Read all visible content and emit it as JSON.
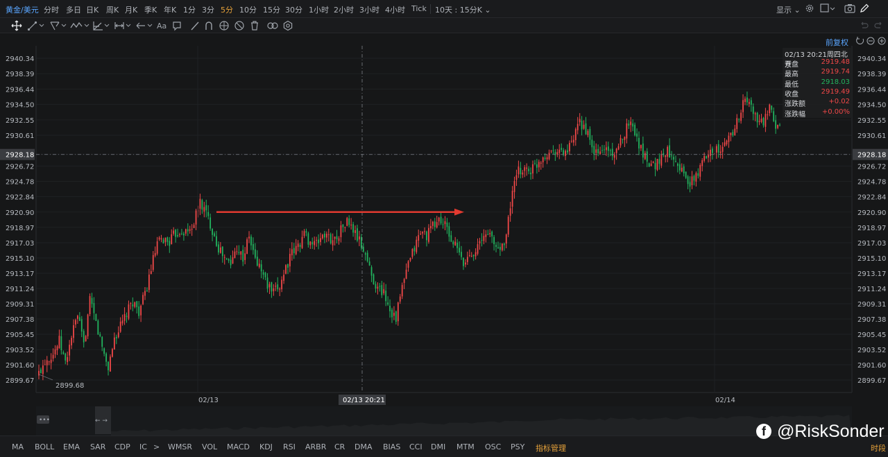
{
  "toolbar": {
    "symbol": "黄金/美元",
    "periods": [
      "分时",
      "多日",
      "日K",
      "周K",
      "月K",
      "季K",
      "年K",
      "1分",
      "3分",
      "5分",
      "10分",
      "15分",
      "30分",
      "1小时",
      "2小时",
      "3小时",
      "4小时",
      "Tick"
    ],
    "active_period": "5分",
    "range_select": "10天 : 15分K",
    "display_label": "显示",
    "icons": [
      "gear-icon",
      "checkbox-icon",
      "camera-icon",
      "pencil-icon"
    ]
  },
  "drawing_tools": [
    "crosshair-icon",
    "trendline-icon",
    "channel-icon",
    "wave-icon",
    "fibonacci-icon",
    "range-icon",
    "arrow-icon",
    "text-icon",
    "note-icon",
    "brush-icon",
    "magnet-icon",
    "eye-icon",
    "hide-icon",
    "trash-icon",
    "link-icon",
    "settings-icon"
  ],
  "text_tool_label": "Aa",
  "fuquan_label": "前复权",
  "tooltip": {
    "datetime": "02/13 20:21周四北京",
    "rows": [
      {
        "label": "开盘",
        "value": "2919.48",
        "color": "#f04848"
      },
      {
        "label": "最高",
        "value": "2919.74",
        "color": "#f04848"
      },
      {
        "label": "最低",
        "value": "2918.03",
        "color": "#22b35e"
      },
      {
        "label": "收盘",
        "value": "2919.49",
        "color": "#f04848"
      },
      {
        "label": "涨跌额",
        "value": "+0.02",
        "color": "#f04848"
      },
      {
        "label": "涨跌幅",
        "value": "+0.00%",
        "color": "#f04848"
      }
    ]
  },
  "chart_data": {
    "type": "candlestick",
    "y_ticks": [
      "2940.34",
      "2938.39",
      "2936.44",
      "2934.50",
      "2932.55",
      "2930.61",
      "2928.18",
      "2926.72",
      "2924.78",
      "2922.84",
      "2920.90",
      "2918.97",
      "2917.03",
      "2915.10",
      "2913.17",
      "2911.24",
      "2909.31",
      "2907.38",
      "2905.45",
      "2903.52",
      "2901.60",
      "2899.67"
    ],
    "ylim": [
      2899.67,
      2940.34
    ],
    "x_labels": [
      "02/13",
      "02/14"
    ],
    "crosshair_time": "02/13 20:21",
    "crosshair_price": "2928.18",
    "min_label": "2899.68",
    "up_color": "#f04848",
    "down_color": "#22b35e",
    "arrow_price": 2920.9,
    "path": [
      [
        0,
        2900.5
      ],
      [
        3,
        2902.2
      ],
      [
        7,
        2903.0
      ],
      [
        10,
        2904.6
      ],
      [
        13,
        2901.8
      ],
      [
        16,
        2905.2
      ],
      [
        19,
        2907.8
      ],
      [
        22,
        2904.0
      ],
      [
        25,
        2909.6
      ],
      [
        28,
        2906.9
      ],
      [
        31,
        2903.8
      ],
      [
        34,
        2901.2
      ],
      [
        37,
        2905.0
      ],
      [
        40,
        2906.4
      ],
      [
        43,
        2908.0
      ],
      [
        46,
        2909.6
      ],
      [
        49,
        2908.4
      ],
      [
        52,
        2910.4
      ],
      [
        55,
        2913.8
      ],
      [
        58,
        2916.8
      ],
      [
        61,
        2917.4
      ],
      [
        64,
        2917.2
      ],
      [
        67,
        2918.2
      ],
      [
        70,
        2918.6
      ],
      [
        73,
        2918.3
      ],
      [
        76,
        2919.6
      ],
      [
        79,
        2922.2
      ],
      [
        82,
        2920.7
      ],
      [
        85,
        2918.7
      ],
      [
        88,
        2916.4
      ],
      [
        91,
        2915.0
      ],
      [
        94,
        2914.3
      ],
      [
        97,
        2916.6
      ],
      [
        100,
        2915.1
      ],
      [
        103,
        2917.8
      ],
      [
        106,
        2914.9
      ],
      [
        109,
        2913.6
      ],
      [
        112,
        2911.6
      ],
      [
        115,
        2910.6
      ],
      [
        118,
        2911.6
      ],
      [
        121,
        2914.0
      ],
      [
        124,
        2915.6
      ],
      [
        127,
        2916.6
      ],
      [
        130,
        2918.2
      ],
      [
        133,
        2917.1
      ],
      [
        136,
        2916.8
      ],
      [
        139,
        2918.1
      ],
      [
        142,
        2917.6
      ],
      [
        145,
        2917.4
      ],
      [
        148,
        2918.7
      ],
      [
        151,
        2919.7
      ],
      [
        154,
        2918.6
      ],
      [
        157,
        2917.2
      ],
      [
        160,
        2915.6
      ],
      [
        163,
        2912.9
      ],
      [
        166,
        2911.2
      ],
      [
        169,
        2910.8
      ],
      [
        172,
        2908.6
      ],
      [
        175,
        2907.6
      ],
      [
        178,
        2911.4
      ],
      [
        181,
        2914.2
      ],
      [
        184,
        2916.4
      ],
      [
        187,
        2918.4
      ],
      [
        190,
        2918.0
      ],
      [
        193,
        2919.1
      ],
      [
        196,
        2920.0
      ],
      [
        199,
        2919.2
      ],
      [
        202,
        2917.4
      ],
      [
        205,
        2916.2
      ],
      [
        208,
        2914.2
      ],
      [
        211,
        2915.6
      ],
      [
        214,
        2916.2
      ],
      [
        217,
        2917.2
      ],
      [
        220,
        2918.6
      ],
      [
        223,
        2916.8
      ],
      [
        226,
        2916.2
      ],
      [
        229,
        2918.0
      ],
      [
        232,
        2923.6
      ],
      [
        235,
        2926.0
      ],
      [
        238,
        2926.4
      ],
      [
        241,
        2926.2
      ],
      [
        244,
        2927.0
      ],
      [
        247,
        2928.0
      ],
      [
        250,
        2928.5
      ],
      [
        253,
        2928.8
      ],
      [
        256,
        2928.4
      ],
      [
        259,
        2928.6
      ],
      [
        262,
        2930.0
      ],
      [
        265,
        2932.2
      ],
      [
        268,
        2931.4
      ],
      [
        271,
        2928.8
      ],
      [
        274,
        2928.2
      ],
      [
        277,
        2929.0
      ],
      [
        280,
        2928.6
      ],
      [
        283,
        2928.2
      ],
      [
        286,
        2930.4
      ],
      [
        289,
        2932.4
      ],
      [
        292,
        2931.2
      ],
      [
        295,
        2928.8
      ],
      [
        298,
        2927.6
      ],
      [
        301,
        2926.8
      ],
      [
        304,
        2927.4
      ],
      [
        307,
        2928.6
      ],
      [
        310,
        2928.4
      ],
      [
        313,
        2927.2
      ],
      [
        316,
        2925.6
      ],
      [
        319,
        2924.4
      ],
      [
        322,
        2925.4
      ],
      [
        325,
        2927.0
      ],
      [
        328,
        2928.8
      ],
      [
        331,
        2928.9
      ],
      [
        334,
        2928.3
      ],
      [
        337,
        2930.0
      ],
      [
        340,
        2931.2
      ],
      [
        343,
        2933.0
      ],
      [
        346,
        2935.2
      ],
      [
        349,
        2934.2
      ],
      [
        352,
        2932.4
      ],
      [
        355,
        2932.2
      ],
      [
        358,
        2933.8
      ],
      [
        361,
        2931.8
      ],
      [
        363,
        2932.1
      ]
    ]
  },
  "indicators": [
    "MA",
    "BOLL",
    "EMA",
    "SAR",
    "CDP",
    "IC",
    ">",
    "WMSR",
    "VOL",
    "MACD",
    "KDJ",
    "RSI",
    "ARBR",
    "CR",
    "DMA",
    "BIAS",
    "CCI",
    "DMI",
    "MTM",
    "OSC",
    "PSY",
    "指标管理"
  ],
  "active_indicator": "指标管理",
  "session_label": "时段",
  "watermark": "@RiskSonder"
}
